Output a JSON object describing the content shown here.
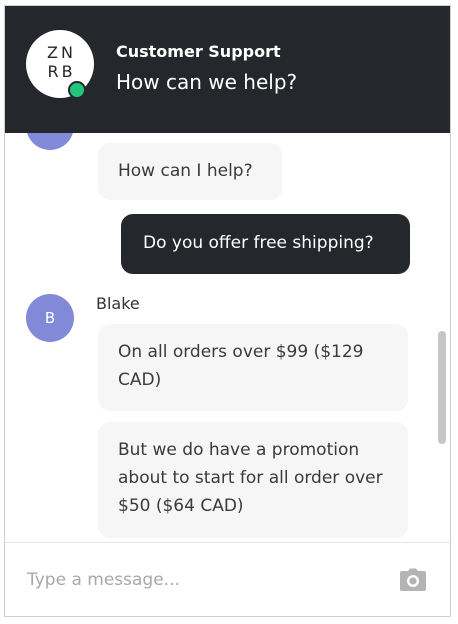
{
  "header": {
    "logo_text": "ZN\nRB",
    "title": "Customer Support",
    "subtitle": "How can we help?",
    "status_color": "#1fc77a"
  },
  "messages": [
    {
      "sender": "agent",
      "avatar_initial": "B",
      "text": "How can I help?"
    },
    {
      "sender": "user",
      "text": "Do you offer free shipping?"
    },
    {
      "sender": "agent",
      "name": "Blake",
      "avatar_initial": "B",
      "text": "On all orders over $99 ($129 CAD)"
    },
    {
      "sender": "agent",
      "text": "But we do have a promotion about to start for all order over $50 ($64 CAD)"
    }
  ],
  "composer": {
    "placeholder": "Type a message...",
    "attach_icon": "camera-icon"
  },
  "colors": {
    "header_bg": "#24272b",
    "avatar_bg": "#8189d8",
    "agent_bubble": "#f6f6f6",
    "user_bubble": "#24272b"
  }
}
